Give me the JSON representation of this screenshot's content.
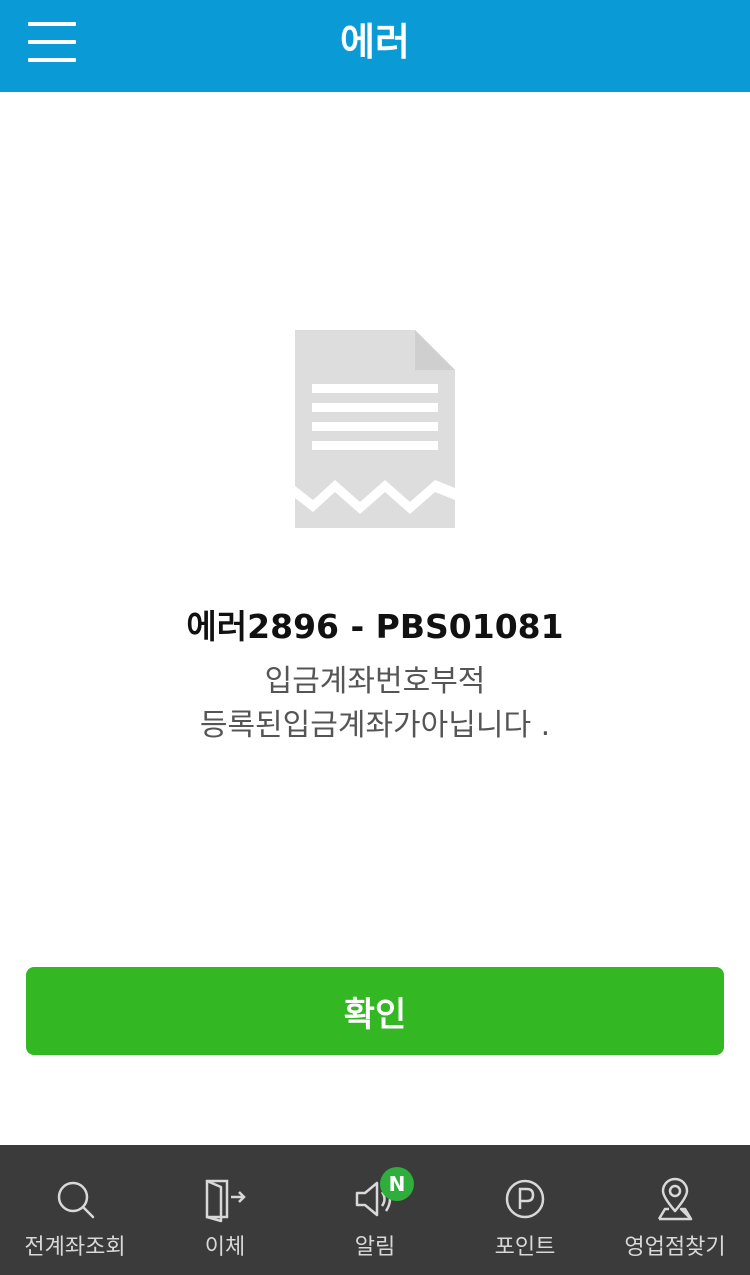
{
  "header": {
    "title": "에러",
    "menu_icon": "hamburger-menu-icon"
  },
  "error": {
    "illustration_icon": "torn-document-icon",
    "code": "에러2896 - PBS01081",
    "message_line1": "입금계좌번호부적",
    "message_line2": "등록된입금계좌가아닙니다 ."
  },
  "actions": {
    "confirm_label": "확인"
  },
  "bottom_nav": {
    "items": [
      {
        "label": "전계좌조회",
        "icon": "search-icon"
      },
      {
        "label": "이체",
        "icon": "transfer-door-icon"
      },
      {
        "label": "알림",
        "icon": "speaker-icon",
        "badge": "N"
      },
      {
        "label": "포인트",
        "icon": "point-icon"
      },
      {
        "label": "영업점찾기",
        "icon": "location-pin-icon"
      }
    ]
  },
  "colors": {
    "header_bg": "#0a9bd6",
    "confirm_bg": "#33b824",
    "nav_bg": "#3b3b3b",
    "badge_bg": "#2fae3c"
  }
}
